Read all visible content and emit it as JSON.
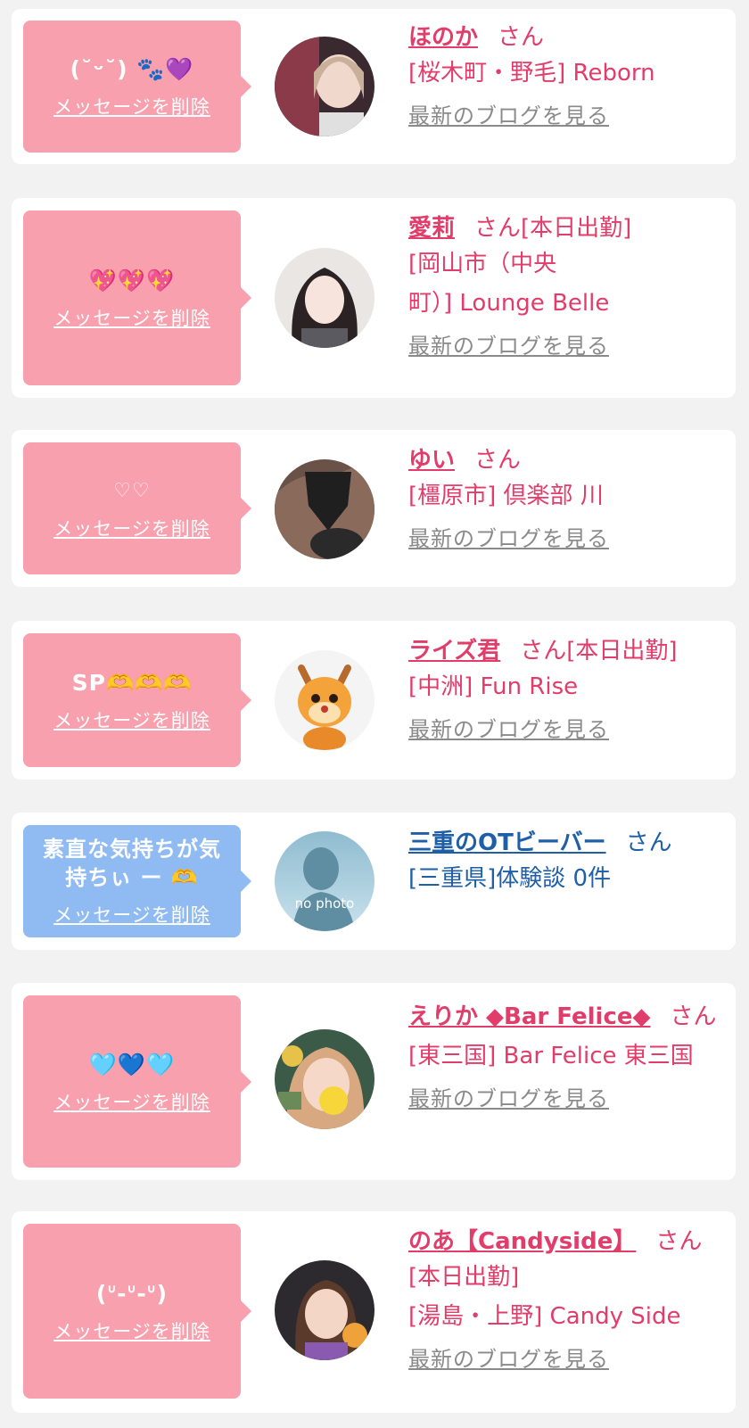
{
  "delete_label": "メッセージを削除",
  "blog_label": "最新のブログを見る",
  "honorific": "さん",
  "items": [
    {
      "message": "(˘ᵕ˘) 🐾💜",
      "name": "ほのか",
      "tag": "",
      "shop": "[桜木町・野毛] Reborn"
    },
    {
      "message": "💖💖💖",
      "name": "愛莉",
      "tag": "[本日出勤]",
      "shop": "[岡山市（中央\n町）] Lounge Belle"
    },
    {
      "message": "♡♡",
      "name": "ゆい",
      "tag": "",
      "shop": "[橿原市] 倶楽部 川"
    },
    {
      "message": "SP🫶🫶🫶",
      "name": "ライズ君",
      "tag": "[本日出勤]",
      "shop": "[中洲] Fun Rise"
    },
    {
      "message": "素直な気持ちが気\n持ちぃ ー 🫶",
      "name": "三重のOTビーバー",
      "tag": "",
      "shop": "[三重県]体験談 0件",
      "avatar_text": "no photo"
    },
    {
      "message": "🩵💙🩵",
      "name": "えりか ◆Bar Felice◆",
      "tag": "",
      "shop": "[東三国] Bar Felice 東三国"
    },
    {
      "message": "(ᐡ-ᐡ-ᐡ)",
      "name": "のあ【Candyside】",
      "tag": "[本日出勤]",
      "shop": "[湯島・上野] Candy Side"
    }
  ]
}
